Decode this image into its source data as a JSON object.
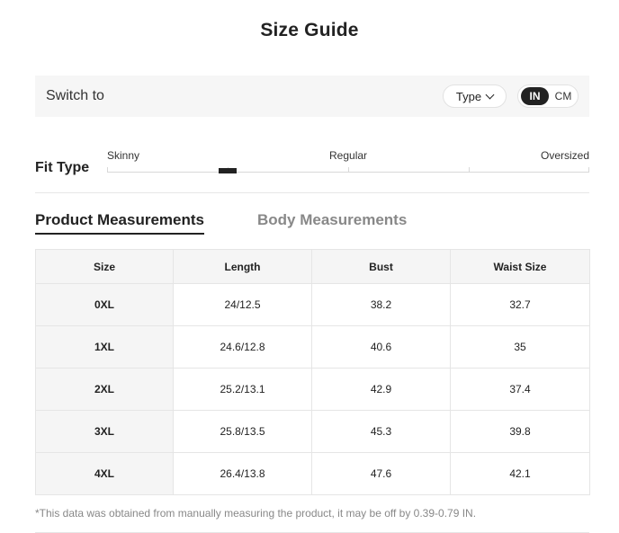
{
  "title": "Size Guide",
  "switch": {
    "label": "Switch to",
    "type_label": "Type",
    "units": [
      "IN",
      "CM"
    ],
    "selected_unit": "IN"
  },
  "fit": {
    "label": "Fit Type",
    "scale": [
      "Skinny",
      "Regular",
      "Oversized"
    ],
    "level": 0.25
  },
  "tabs": [
    {
      "label": "Product Measurements",
      "active": true
    },
    {
      "label": "Body Measurements",
      "active": false
    }
  ],
  "table": {
    "headers": [
      "Size",
      "Length",
      "Bust",
      "Waist Size"
    ],
    "rows": [
      [
        "0XL",
        "24/12.5",
        "38.2",
        "32.7"
      ],
      [
        "1XL",
        "24.6/12.8",
        "40.6",
        "35"
      ],
      [
        "2XL",
        "25.2/13.1",
        "42.9",
        "37.4"
      ],
      [
        "3XL",
        "25.8/13.5",
        "45.3",
        "39.8"
      ],
      [
        "4XL",
        "26.4/13.8",
        "47.6",
        "42.1"
      ]
    ]
  },
  "note": "*This data was obtained from manually measuring the product, it may be off by 0.39-0.79 IN."
}
